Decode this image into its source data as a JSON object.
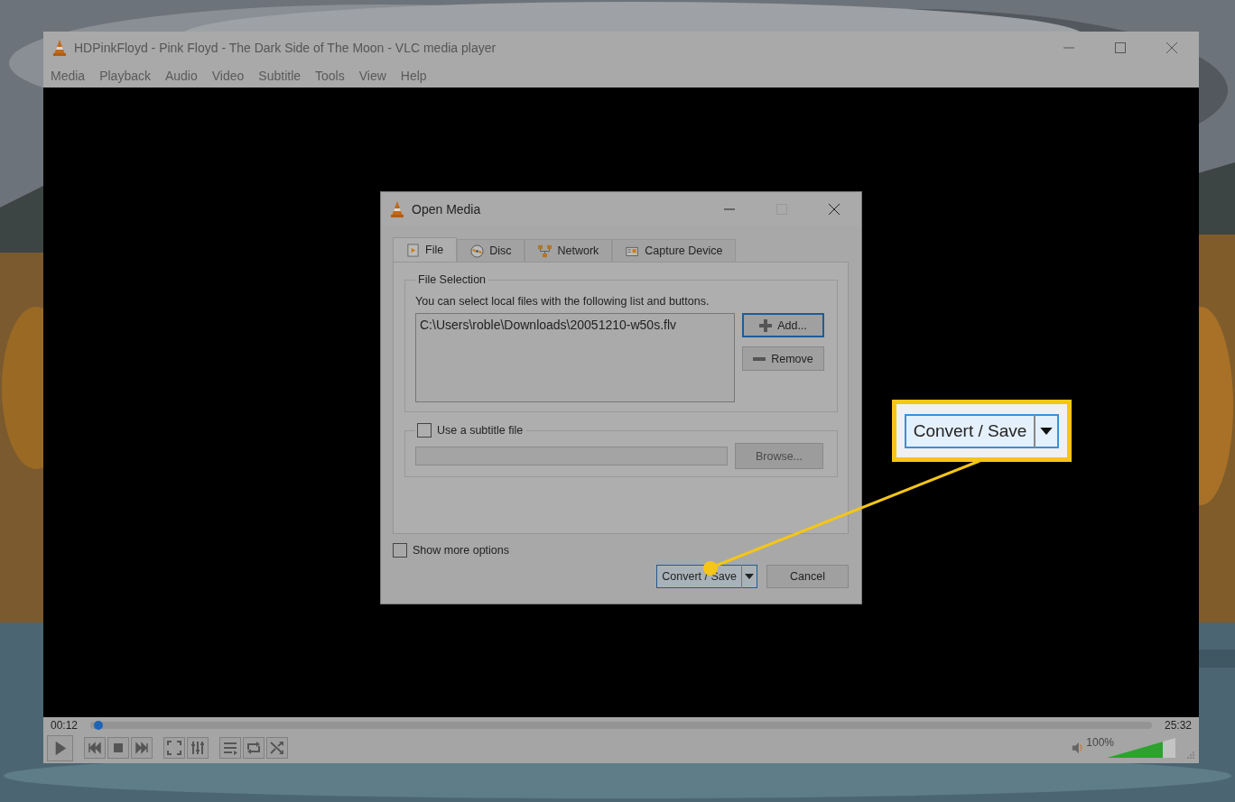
{
  "player": {
    "title": "HDPinkFloyd - Pink Floyd - The Dark Side of The Moon - VLC media player",
    "menu": [
      "Media",
      "Playback",
      "Audio",
      "Video",
      "Subtitle",
      "Tools",
      "View",
      "Help"
    ],
    "elapsed": "00:12",
    "total": "25:32",
    "progress": {
      "level": 0.003
    },
    "volume": {
      "reading": "100%",
      "level": 0.82
    }
  },
  "dialog": {
    "title": "Open Media",
    "tabs": [
      {
        "label": "File",
        "kind": "file",
        "selected": true
      },
      {
        "label": "Disc",
        "kind": "disc",
        "selected": false
      },
      {
        "label": "Network",
        "kind": "network",
        "selected": false
      },
      {
        "label": "Capture Device",
        "kind": "capture",
        "selected": false
      }
    ],
    "file_selection": {
      "legend": "File Selection",
      "hint": "You can select local files with the following list and buttons.",
      "files": [
        "C:\\Users\\roble\\Downloads\\20051210-w50s.flv"
      ],
      "buttons": [
        {
          "label": "Add...",
          "kind": "add",
          "focused": true
        },
        {
          "label": "Remove",
          "kind": "remove",
          "focused": false
        }
      ]
    },
    "subtitle": {
      "label": "Use a subtitle file",
      "checked": false,
      "browse": {
        "label": "Browse...",
        "disabled": true
      }
    },
    "show_more_options": {
      "label": "Show more options",
      "checked": false
    },
    "convert_button": "Convert / Save",
    "cancel_button": "Cancel"
  },
  "callout": {
    "label": "Convert / Save"
  }
}
